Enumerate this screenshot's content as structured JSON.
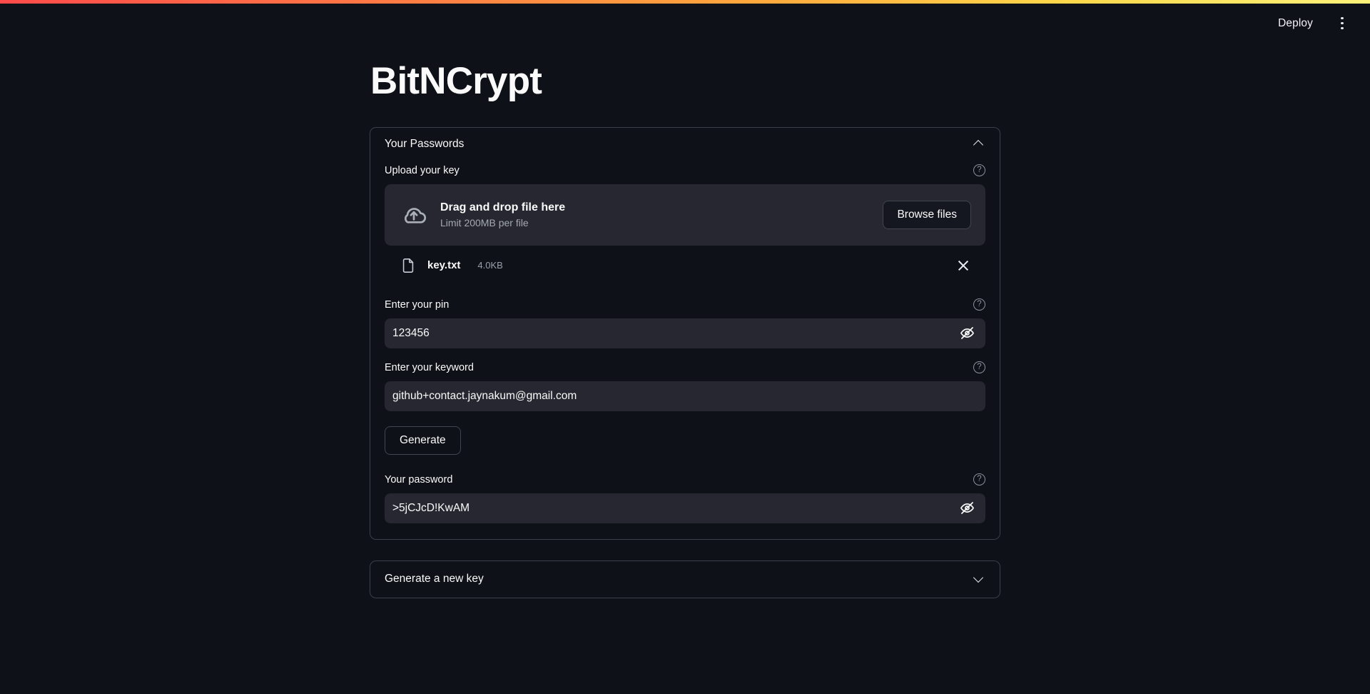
{
  "header": {
    "deploy_label": "Deploy",
    "menu_icon": "kebab-menu-icon",
    "gradient": [
      "#ff4b4b",
      "#ffa83d",
      "#fff27a"
    ]
  },
  "app": {
    "title": "BitNCrypt",
    "background": "#0e1117",
    "surface": "#262730",
    "text": "#fafafa",
    "muted": "#a3a8b4",
    "border": "#3a3f4b"
  },
  "passwords_expander": {
    "title": "Your Passwords",
    "chevron": "chevron-up-icon",
    "upload": {
      "label": "Upload your key",
      "help_icon": "help-circle-icon",
      "dropzone_icon": "cloud-upload-icon",
      "dropzone_title": "Drag and drop file here",
      "dropzone_subtitle": "Limit 200MB per file",
      "browse_label": "Browse files"
    },
    "uploaded_file": {
      "icon": "file-icon",
      "name": "key.txt",
      "size": "4.0KB",
      "remove_icon": "close-icon"
    },
    "pin_field": {
      "label": "Enter your pin",
      "help_icon": "help-circle-icon",
      "value": "123456",
      "placeholder": "",
      "toggle_icon": "eye-off-icon"
    },
    "keyword_field": {
      "label": "Enter your keyword",
      "help_icon": "help-circle-icon",
      "value": "github+contact.jaynakum@gmail.com",
      "placeholder": ""
    },
    "generate_label": "Generate",
    "password_field": {
      "label": "Your password",
      "help_icon": "help-circle-icon",
      "value": ">5jCJcD!KwAM",
      "placeholder": "",
      "toggle_icon": "eye-off-icon"
    }
  },
  "new_key_expander": {
    "title": "Generate a new key",
    "chevron": "chevron-down-icon"
  }
}
